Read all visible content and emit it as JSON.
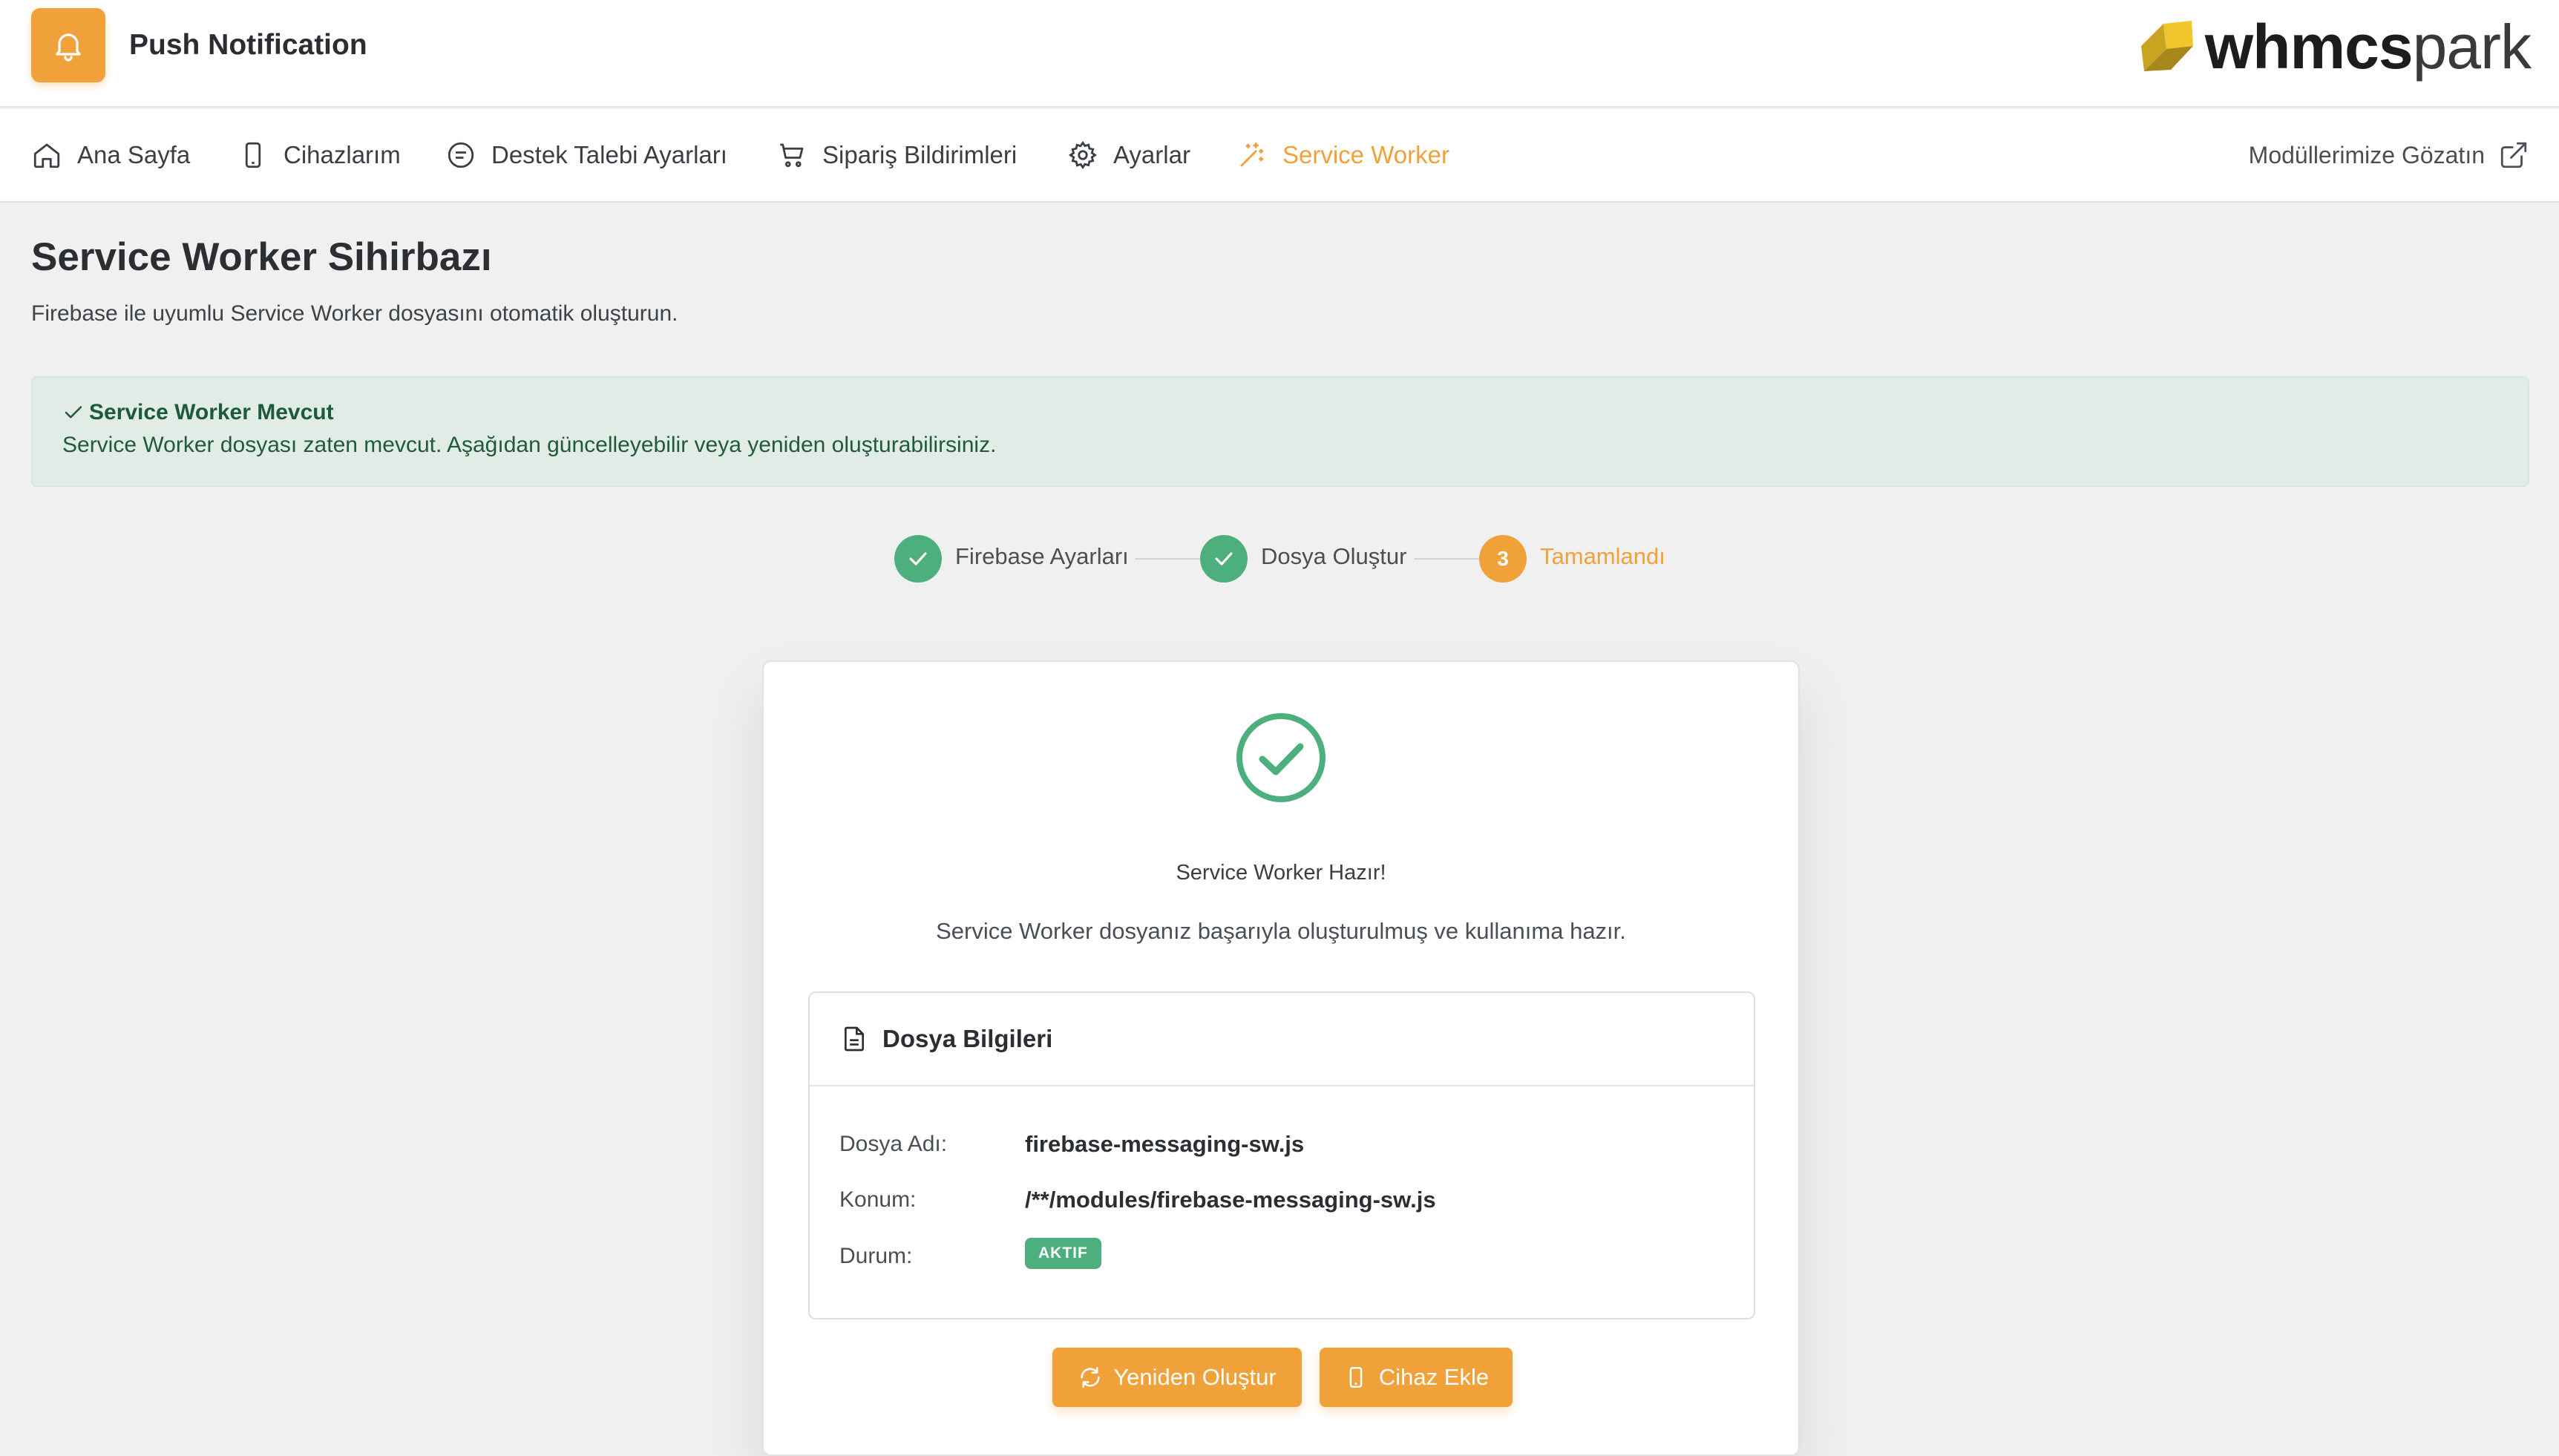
{
  "app": {
    "title": "Push Notification",
    "brand_bold": "whmcs",
    "brand_light": "park"
  },
  "nav": {
    "items": [
      {
        "label": "Ana Sayfa",
        "icon": "home-icon"
      },
      {
        "label": "Cihazlarım",
        "icon": "mobile-icon"
      },
      {
        "label": "Destek Talebi Ayarları",
        "icon": "ticket-icon"
      },
      {
        "label": "Sipariş Bildirimleri",
        "icon": "cart-icon"
      },
      {
        "label": "Ayarlar",
        "icon": "gear-icon"
      },
      {
        "label": "Service Worker",
        "icon": "magic-wand-icon",
        "active": true
      }
    ],
    "external": "Modüllerimize Gözatın"
  },
  "page": {
    "title": "Service Worker Sihirbazı",
    "subtitle": "Firebase ile uyumlu Service Worker dosyasını otomatik oluşturun."
  },
  "alert": {
    "title": "Service Worker Mevcut",
    "text": "Service Worker dosyası zaten mevcut. Aşağıdan güncelleyebilir veya yeniden oluşturabilirsiniz."
  },
  "steps": [
    {
      "label": "Firebase Ayarları",
      "state": "done"
    },
    {
      "label": "Dosya Oluştur",
      "state": "done"
    },
    {
      "label": "Tamamlandı",
      "state": "current",
      "number": "3"
    }
  ],
  "result": {
    "title": "Service Worker Hazır!",
    "text": "Service Worker dosyanız başarıyla oluşturulmuş ve kullanıma hazır."
  },
  "file_info": {
    "header": "Dosya Bilgileri",
    "name_label": "Dosya Adı:",
    "name_value": "firebase-messaging-sw.js",
    "location_label": "Konum:",
    "location_value": "/**/modules/firebase-messaging-sw.js",
    "status_label": "Durum:",
    "status_value": "AKTIF"
  },
  "buttons": {
    "regenerate": "Yeniden Oluştur",
    "add_device": "Cihaz Ekle"
  },
  "colors": {
    "accent": "#f0a13a",
    "success": "#4caf7d",
    "alert_bg": "#e2ece6"
  }
}
